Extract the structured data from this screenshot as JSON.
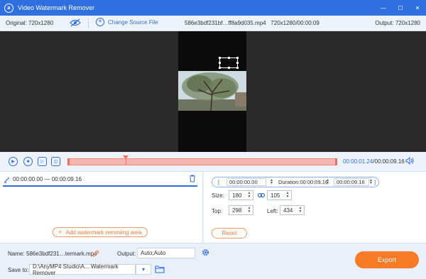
{
  "app": {
    "title": "Video Watermark Remover",
    "logo_letter": "a",
    "accent": "#2f6fdf"
  },
  "window": {
    "minimize": "—",
    "maximize": "☐",
    "close": "✕"
  },
  "infobar": {
    "original": "Original: 720x1280",
    "change_source": "Change Source File",
    "file_name": "586e3bdf231bf…ff8a9d035.mp4",
    "file_meta": "720x1280/00:00:09",
    "output": "Output: 720x1280"
  },
  "playback": {
    "current": "00:00:01.24",
    "total": "/00:00:09.16",
    "progress_fraction": 0.215
  },
  "segment": {
    "range": "00:00:00.00 — 00:00:09.16"
  },
  "actions": {
    "add_area": "Add watermark removing area",
    "reset": "Reset",
    "export": "Export"
  },
  "time_range": {
    "start": "00:00:00.00",
    "duration_label": "Duration:",
    "duration": "00:00:09.16",
    "end": "00:00:09.16"
  },
  "size": {
    "label": "Size:",
    "width": "180",
    "height": "105"
  },
  "position": {
    "top_label": "Top:",
    "top": "298",
    "left_label": "Left:",
    "left": "434"
  },
  "output_settings": {
    "name_label": "Name:",
    "name_value": "586e3bdf231…termark.mp4",
    "output_label": "Output:",
    "output_value": "Auto;Auto",
    "save_label": "Save to:",
    "save_path": "D:\\AnyMP4 Studio\\A... Watermark Remover"
  }
}
